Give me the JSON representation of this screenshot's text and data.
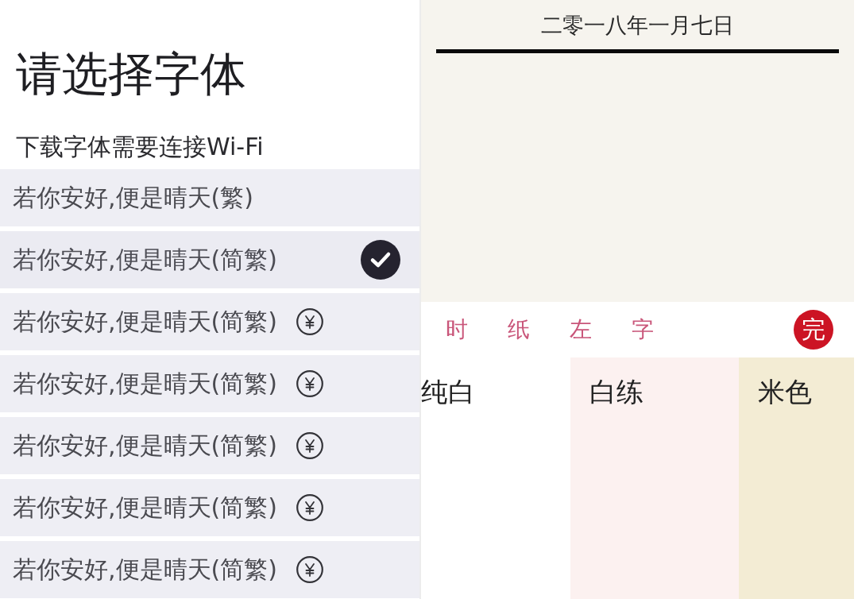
{
  "font_panel": {
    "title": "请选择字体",
    "subtitle": "下载字体需要连接Wi-Fi",
    "fonts": [
      {
        "label": "若你安好,便是晴天(繁)",
        "selected": false,
        "paid": false
      },
      {
        "label": "若你安好,便是晴天(简繁)",
        "selected": true,
        "paid": false
      },
      {
        "label": "若你安好,便是晴天(简繁)",
        "selected": false,
        "paid": true
      },
      {
        "label": "若你安好,便是晴天(简繁)",
        "selected": false,
        "paid": true
      },
      {
        "label": "若你安好,便是晴天(简繁)",
        "selected": false,
        "paid": true
      },
      {
        "label": "若你安好,便是晴天(简繁)",
        "selected": false,
        "paid": true
      },
      {
        "label": "若你安好,便是晴天(简繁)",
        "selected": false,
        "paid": true
      }
    ]
  },
  "paper_panel": {
    "date": "二零一八年一月七日",
    "toolbar": {
      "tabs": [
        "时",
        "纸",
        "左",
        "字"
      ],
      "done": "完"
    },
    "papers": [
      {
        "name": "纯白",
        "color": "#ffffff"
      },
      {
        "name": "白练",
        "color": "#fcf1f0"
      },
      {
        "name": "米色",
        "color": "#f3ecd4"
      }
    ]
  }
}
